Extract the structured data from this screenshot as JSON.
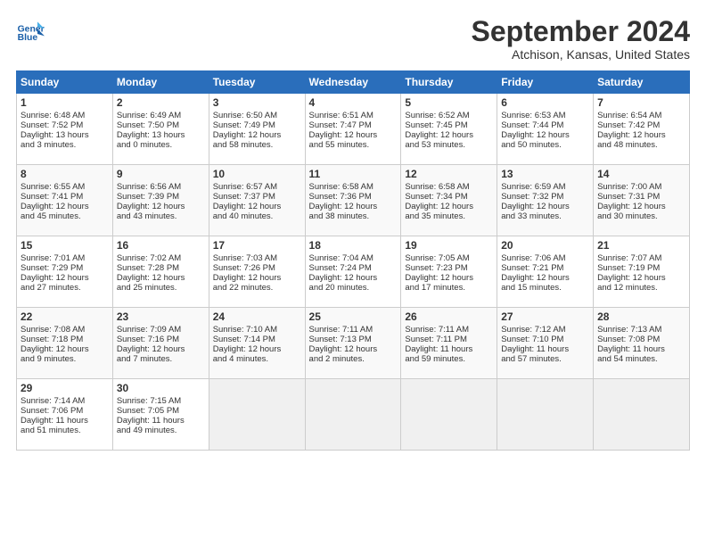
{
  "logo": {
    "line1": "General",
    "line2": "Blue"
  },
  "title": "September 2024",
  "location": "Atchison, Kansas, United States",
  "days_of_week": [
    "Sunday",
    "Monday",
    "Tuesday",
    "Wednesday",
    "Thursday",
    "Friday",
    "Saturday"
  ],
  "weeks": [
    [
      {
        "day": 1,
        "lines": [
          "Sunrise: 6:48 AM",
          "Sunset: 7:52 PM",
          "Daylight: 13 hours",
          "and 3 minutes."
        ]
      },
      {
        "day": 2,
        "lines": [
          "Sunrise: 6:49 AM",
          "Sunset: 7:50 PM",
          "Daylight: 13 hours",
          "and 0 minutes."
        ]
      },
      {
        "day": 3,
        "lines": [
          "Sunrise: 6:50 AM",
          "Sunset: 7:49 PM",
          "Daylight: 12 hours",
          "and 58 minutes."
        ]
      },
      {
        "day": 4,
        "lines": [
          "Sunrise: 6:51 AM",
          "Sunset: 7:47 PM",
          "Daylight: 12 hours",
          "and 55 minutes."
        ]
      },
      {
        "day": 5,
        "lines": [
          "Sunrise: 6:52 AM",
          "Sunset: 7:45 PM",
          "Daylight: 12 hours",
          "and 53 minutes."
        ]
      },
      {
        "day": 6,
        "lines": [
          "Sunrise: 6:53 AM",
          "Sunset: 7:44 PM",
          "Daylight: 12 hours",
          "and 50 minutes."
        ]
      },
      {
        "day": 7,
        "lines": [
          "Sunrise: 6:54 AM",
          "Sunset: 7:42 PM",
          "Daylight: 12 hours",
          "and 48 minutes."
        ]
      }
    ],
    [
      {
        "day": 8,
        "lines": [
          "Sunrise: 6:55 AM",
          "Sunset: 7:41 PM",
          "Daylight: 12 hours",
          "and 45 minutes."
        ]
      },
      {
        "day": 9,
        "lines": [
          "Sunrise: 6:56 AM",
          "Sunset: 7:39 PM",
          "Daylight: 12 hours",
          "and 43 minutes."
        ]
      },
      {
        "day": 10,
        "lines": [
          "Sunrise: 6:57 AM",
          "Sunset: 7:37 PM",
          "Daylight: 12 hours",
          "and 40 minutes."
        ]
      },
      {
        "day": 11,
        "lines": [
          "Sunrise: 6:58 AM",
          "Sunset: 7:36 PM",
          "Daylight: 12 hours",
          "and 38 minutes."
        ]
      },
      {
        "day": 12,
        "lines": [
          "Sunrise: 6:58 AM",
          "Sunset: 7:34 PM",
          "Daylight: 12 hours",
          "and 35 minutes."
        ]
      },
      {
        "day": 13,
        "lines": [
          "Sunrise: 6:59 AM",
          "Sunset: 7:32 PM",
          "Daylight: 12 hours",
          "and 33 minutes."
        ]
      },
      {
        "day": 14,
        "lines": [
          "Sunrise: 7:00 AM",
          "Sunset: 7:31 PM",
          "Daylight: 12 hours",
          "and 30 minutes."
        ]
      }
    ],
    [
      {
        "day": 15,
        "lines": [
          "Sunrise: 7:01 AM",
          "Sunset: 7:29 PM",
          "Daylight: 12 hours",
          "and 27 minutes."
        ]
      },
      {
        "day": 16,
        "lines": [
          "Sunrise: 7:02 AM",
          "Sunset: 7:28 PM",
          "Daylight: 12 hours",
          "and 25 minutes."
        ]
      },
      {
        "day": 17,
        "lines": [
          "Sunrise: 7:03 AM",
          "Sunset: 7:26 PM",
          "Daylight: 12 hours",
          "and 22 minutes."
        ]
      },
      {
        "day": 18,
        "lines": [
          "Sunrise: 7:04 AM",
          "Sunset: 7:24 PM",
          "Daylight: 12 hours",
          "and 20 minutes."
        ]
      },
      {
        "day": 19,
        "lines": [
          "Sunrise: 7:05 AM",
          "Sunset: 7:23 PM",
          "Daylight: 12 hours",
          "and 17 minutes."
        ]
      },
      {
        "day": 20,
        "lines": [
          "Sunrise: 7:06 AM",
          "Sunset: 7:21 PM",
          "Daylight: 12 hours",
          "and 15 minutes."
        ]
      },
      {
        "day": 21,
        "lines": [
          "Sunrise: 7:07 AM",
          "Sunset: 7:19 PM",
          "Daylight: 12 hours",
          "and 12 minutes."
        ]
      }
    ],
    [
      {
        "day": 22,
        "lines": [
          "Sunrise: 7:08 AM",
          "Sunset: 7:18 PM",
          "Daylight: 12 hours",
          "and 9 minutes."
        ]
      },
      {
        "day": 23,
        "lines": [
          "Sunrise: 7:09 AM",
          "Sunset: 7:16 PM",
          "Daylight: 12 hours",
          "and 7 minutes."
        ]
      },
      {
        "day": 24,
        "lines": [
          "Sunrise: 7:10 AM",
          "Sunset: 7:14 PM",
          "Daylight: 12 hours",
          "and 4 minutes."
        ]
      },
      {
        "day": 25,
        "lines": [
          "Sunrise: 7:11 AM",
          "Sunset: 7:13 PM",
          "Daylight: 12 hours",
          "and 2 minutes."
        ]
      },
      {
        "day": 26,
        "lines": [
          "Sunrise: 7:11 AM",
          "Sunset: 7:11 PM",
          "Daylight: 11 hours",
          "and 59 minutes."
        ]
      },
      {
        "day": 27,
        "lines": [
          "Sunrise: 7:12 AM",
          "Sunset: 7:10 PM",
          "Daylight: 11 hours",
          "and 57 minutes."
        ]
      },
      {
        "day": 28,
        "lines": [
          "Sunrise: 7:13 AM",
          "Sunset: 7:08 PM",
          "Daylight: 11 hours",
          "and 54 minutes."
        ]
      }
    ],
    [
      {
        "day": 29,
        "lines": [
          "Sunrise: 7:14 AM",
          "Sunset: 7:06 PM",
          "Daylight: 11 hours",
          "and 51 minutes."
        ]
      },
      {
        "day": 30,
        "lines": [
          "Sunrise: 7:15 AM",
          "Sunset: 7:05 PM",
          "Daylight: 11 hours",
          "and 49 minutes."
        ]
      },
      null,
      null,
      null,
      null,
      null
    ]
  ]
}
